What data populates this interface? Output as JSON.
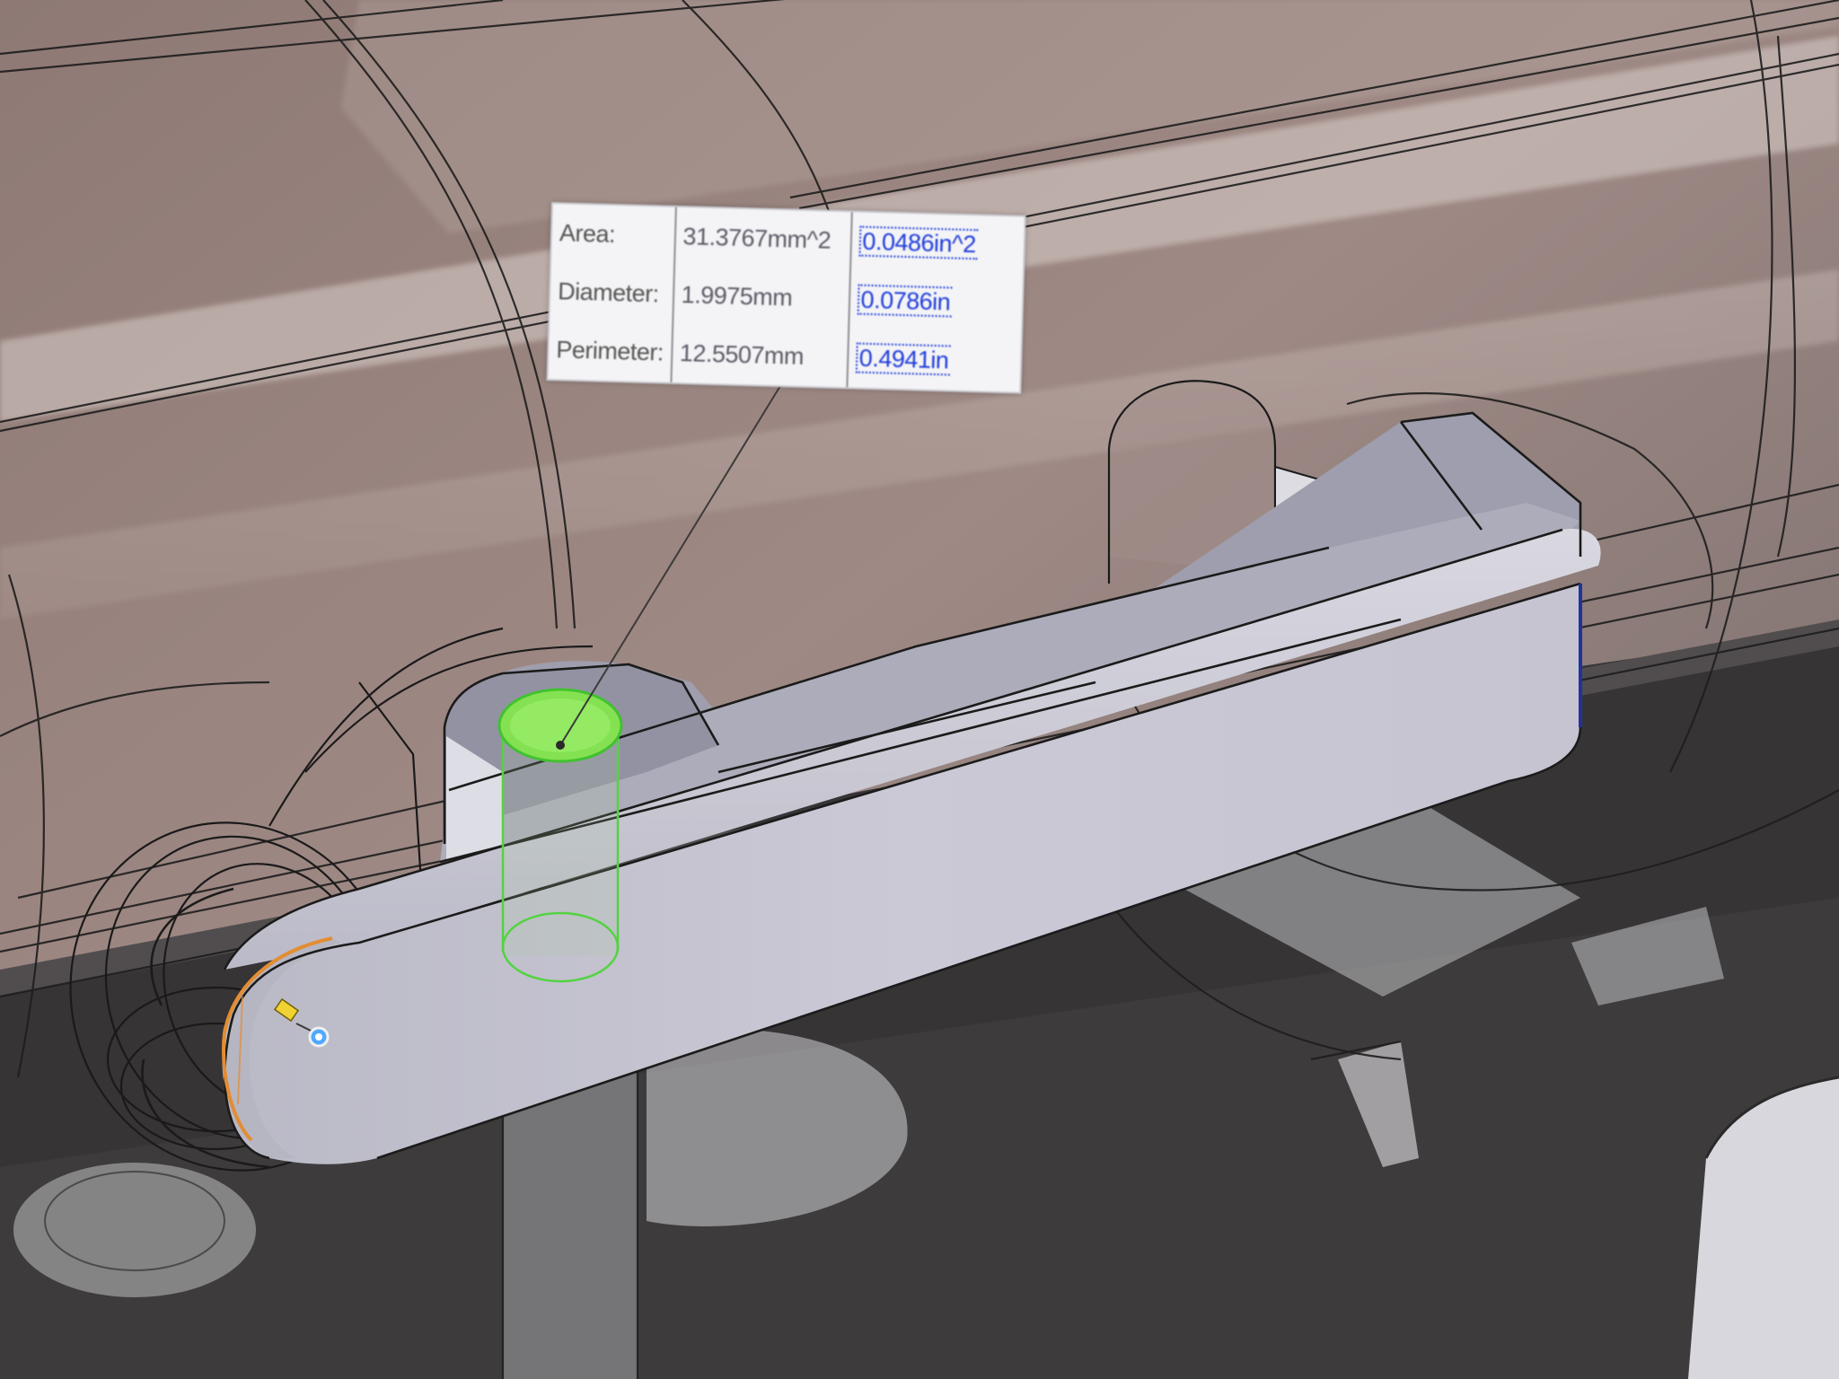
{
  "measurement": {
    "rows": [
      {
        "label": "Area:",
        "value_mm": "31.3767mm^2",
        "value_in": "0.0486in^2"
      },
      {
        "label": "Diameter:",
        "value_mm": "1.9975mm",
        "value_in": "0.0786in"
      },
      {
        "label": "Perimeter:",
        "value_mm": "12.5507mm",
        "value_in": "0.4941in"
      }
    ]
  },
  "colors": {
    "selected_face": "#7fe04a",
    "selected_edge": "#e2892a",
    "part_body": "#c7c6d1",
    "transparent_bg": "#8d7874",
    "floor_dark": "#2b2a2c",
    "inch_value": "#1f3cd9"
  },
  "icons": {
    "triad": "coordinate-triad-icon",
    "selection_marker": "selection-point-icon"
  }
}
